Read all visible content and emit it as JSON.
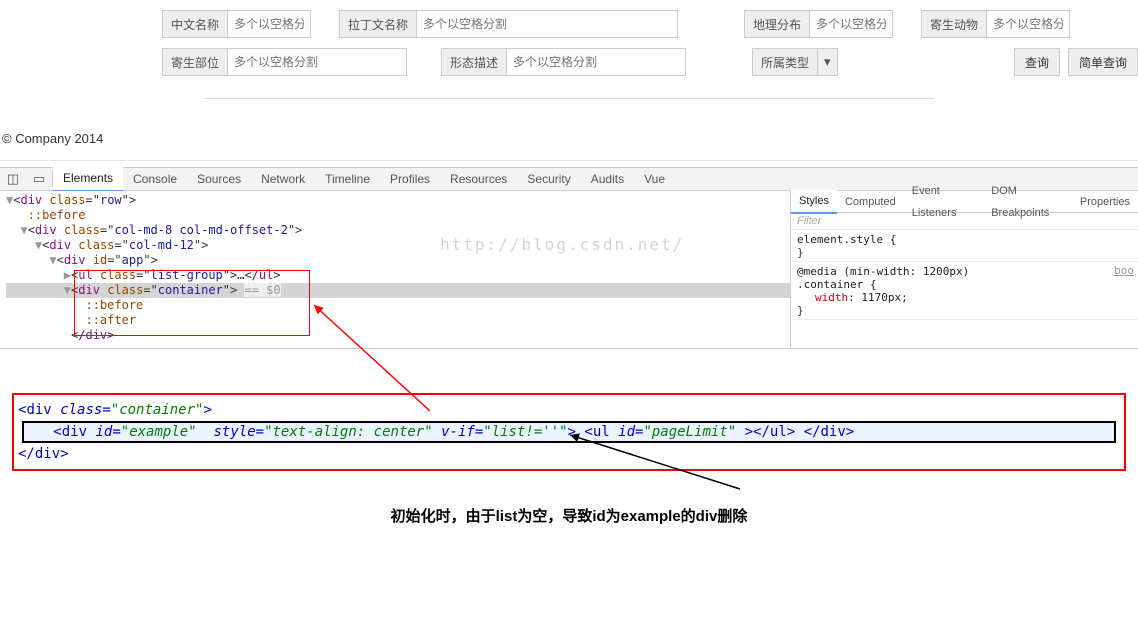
{
  "form": {
    "cn_name_label": "中文名称",
    "ph_multi": "多个以空格分割",
    "ph_multi_trunc": "多个以空格分",
    "latin_label": "拉丁文名称",
    "geo_label": "地理分布",
    "parasitic_animal_label": "寄生动物",
    "parasitic_part_label": "寄生部位",
    "desc_label": "形态描述",
    "type_label": "所属类型",
    "btn_query": "查询",
    "btn_simple": "简单查询"
  },
  "copyright": "© Company 2014",
  "devtools": {
    "tabs": [
      "Elements",
      "Console",
      "Sources",
      "Network",
      "Timeline",
      "Profiles",
      "Resources",
      "Security",
      "Audits",
      "Vue"
    ],
    "tree": {
      "l0": "▼<div class=\"row\">",
      "l1": "  ::before",
      "l2": "  ▼<div class=\"col-md-8 col-md-offset-2\">",
      "l3": "    ▼<div class=\"col-md-12\">",
      "l4": "      ▼<div id=\"app\">",
      "l5_a": "        ▶<ul class=\"list-group\">…</ul>",
      "l5_b": "        ▼<div class=\"container\"> == $0",
      "l6": "          ::before",
      "l7": "          ::after",
      "l8": "        </div>"
    },
    "watermark": "http://blog.csdn.net/",
    "styles_tabs": [
      "Styles",
      "Computed",
      "Event Listeners",
      "DOM Breakpoints",
      "Properties"
    ],
    "filter": "Filter",
    "rule1": "element.style {",
    "rule1c": "}",
    "rule2_media": "@media (min-width: 1200px)",
    "rule2_sel": ".container {",
    "rule2_prop": "width",
    "rule2_val": "1170px;",
    "rule2_src": "boo",
    "rule2_c": "}"
  },
  "snippet": {
    "open": "<div class=\"container\">",
    "inner": "   <div id=\"example\"  style=\"text-align: center\" v-if=\"list!=''\"> <ul id=\"pageLimit\" ></ul> </div>",
    "close": "</div>"
  },
  "annotation": "初始化时，由于list为空，导致id为example的div删除"
}
